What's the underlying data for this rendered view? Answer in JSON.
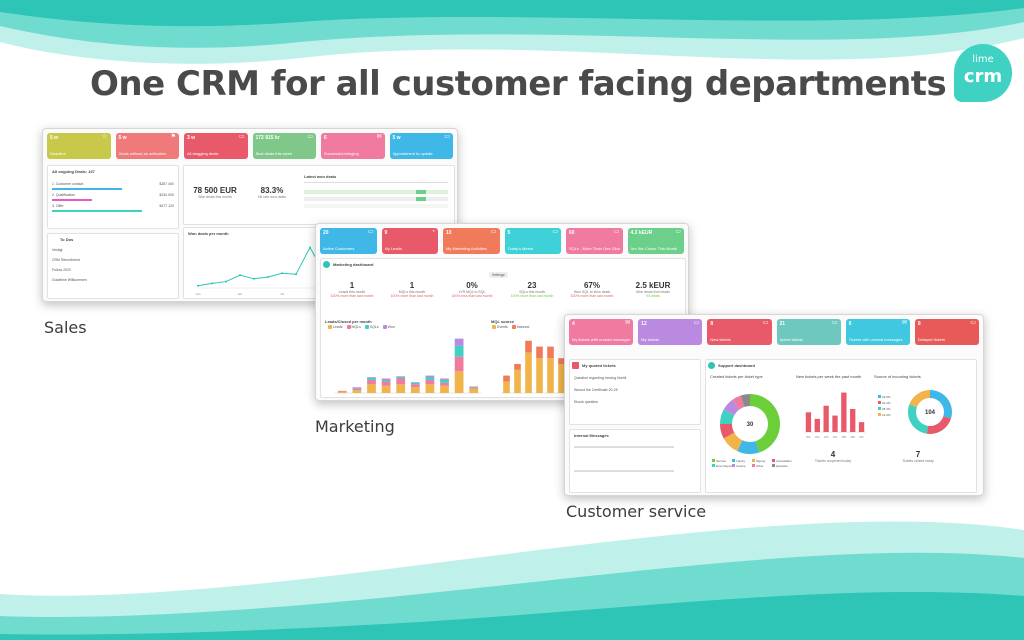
{
  "headline": "One CRM for all customer facing departments",
  "logo": {
    "line1": "lime",
    "line2": "crm",
    "color": "#3fd1c2"
  },
  "captions": {
    "sales": "Sales",
    "marketing": "Marketing",
    "customer_service": "Customer service"
  },
  "colors": {
    "teal_light": "#bff0ea",
    "teal": "#6fdccf",
    "teal_dark": "#2ec4b6"
  },
  "sales": {
    "tiles": [
      {
        "value": "5 w",
        "label": "Deadline",
        "color": "#c8c84a"
      },
      {
        "value": "5 w",
        "label": "Deals without an activation",
        "color": "#f07a7a"
      },
      {
        "value": "3 w",
        "label": "All stagging deals",
        "color": "#e85a6a"
      },
      {
        "value": "172 815 kr",
        "label": "Best deals this week",
        "color": "#7fc88a"
      },
      {
        "value": "6",
        "label": "Successful bringing",
        "color": "#f07aa0"
      },
      {
        "value": "5 w",
        "label": "Appointment to update",
        "color": "#3fb8e8"
      }
    ],
    "deals": {
      "title": "All ongoing Deals: 167",
      "rows": [
        "1. Customer contact",
        "2. Qualification",
        "3. Offer"
      ],
      "amounts": [
        "$287 400",
        "$234 000",
        "$477 120"
      ]
    },
    "kpis": [
      {
        "value": "78 500 EUR",
        "label": "Won deals this month"
      },
      {
        "value": "83.3%",
        "label": "Hit rate won deals"
      }
    ],
    "latest_title": "Latest won deals",
    "todo": {
      "title": "To Dos",
      "items": [
        "Vestigt",
        "CRM Recruitment",
        "Follow 2020",
        "Guideline Willkommen"
      ]
    },
    "chart_title": "Won deals per month",
    "chart_data": {
      "type": "line",
      "x": [
        "Jan",
        "Feb",
        "Mar",
        "Apr",
        "May",
        "Jun",
        "Jul",
        "Aug",
        "Sep",
        "Oct",
        "Nov",
        "Dec"
      ],
      "series": [
        {
          "values": [
            5,
            10,
            14,
            28,
            20,
            24,
            32,
            30,
            88,
            34,
            28,
            30
          ]
        }
      ],
      "ylim": [
        0,
        100
      ]
    }
  },
  "marketing": {
    "tiles": [
      {
        "value": "20",
        "label": "Active Customers",
        "color": "#3fb8e8"
      },
      {
        "value": "9",
        "label": "My Leads",
        "color": "#e85a6a"
      },
      {
        "value": "10",
        "label": "My Marketing Activities",
        "color": "#f07a5a"
      },
      {
        "value": "5",
        "label": "Today's Meets",
        "color": "#3fd1d8"
      },
      {
        "value": "60",
        "label": "SQLs - More Than One Click",
        "color": "#f07aa0"
      },
      {
        "value": "4.3 kEUR",
        "label": "Are We Closer This Month",
        "color": "#6ccf8a"
      }
    ],
    "dashboard_title": "Marketing dashboard",
    "settings_label": "Settings",
    "kpis": [
      {
        "value": "1",
        "label": "Leads this month",
        "sub": "100% more than last month"
      },
      {
        "value": "1",
        "label": "MQLs this month",
        "sub": "100% more than last month"
      },
      {
        "value": "0%",
        "label": "LYR MQL to SQL",
        "sub": "100% less than last month"
      },
      {
        "value": "23",
        "label": "SQLs this month",
        "sub": "100% more than last month"
      },
      {
        "value": "67%",
        "label": "Won SQL to Won deals",
        "sub": "100% more than last month"
      },
      {
        "value": "2.5 kEUR",
        "label": "Won deals from leads",
        "sub": "93 deals"
      }
    ],
    "chart1": {
      "title": "Leads/Closed per month",
      "legend": [
        "Leads",
        "MQLs",
        "SQLs",
        "Won"
      ],
      "colors": [
        "#f0b44a",
        "#f07aa0",
        "#3fd1c2",
        "#b98ae0"
      ],
      "chart_data": {
        "type": "bar",
        "categories": [
          "Jan",
          "Feb",
          "Mar",
          "Apr",
          "May",
          "Jun",
          "Jul",
          "Aug",
          "Sep",
          "Oct"
        ],
        "series": [
          {
            "name": "Leads",
            "values": [
              2,
              4,
              12,
              10,
              12,
              8,
              12,
              10,
              30,
              6
            ]
          },
          {
            "name": "MQLs",
            "values": [
              1,
              2,
              6,
              6,
              8,
              4,
              6,
              4,
              20,
              2
            ]
          },
          {
            "name": "SQLs",
            "values": [
              0,
              1,
              3,
              2,
              2,
              2,
              4,
              4,
              15,
              1
            ]
          },
          {
            "name": "Won",
            "values": [
              0,
              1,
              1,
              2,
              1,
              1,
              2,
              2,
              10,
              0
            ]
          }
        ],
        "ylim": [
          0,
          80
        ]
      }
    },
    "chart2": {
      "title": "MQL source",
      "legend": [
        "Events",
        "Inbound"
      ],
      "colors": [
        "#f0b44a",
        "#f07a5a"
      ],
      "chart_data": {
        "type": "bar",
        "categories": [
          "A",
          "B",
          "C",
          "D",
          "E",
          "F"
        ],
        "series": [
          {
            "name": "Events",
            "values": [
              2,
              4,
              7,
              6,
              6,
              5
            ]
          },
          {
            "name": "Inbound",
            "values": [
              1,
              1,
              2,
              2,
              2,
              1
            ]
          }
        ],
        "ylim": [
          0,
          10
        ]
      }
    }
  },
  "service": {
    "tiles": [
      {
        "value": "4",
        "label": "My tickets with unread messages",
        "color": "#f07aa0"
      },
      {
        "value": "12",
        "label": "My tickets",
        "color": "#b98ae0"
      },
      {
        "value": "8",
        "label": "New tickets",
        "color": "#e85a6a"
      },
      {
        "value": "21",
        "label": "Active tickets",
        "color": "#6fc8c0"
      },
      {
        "value": "6",
        "label": "Tickets with unread messages",
        "color": "#3fc8e0"
      },
      {
        "value": "8",
        "label": "Delayed tickets",
        "color": "#e85a5a"
      }
    ],
    "list_title": "My quoted tickets",
    "list_items": [
      "Question regarding moving Norbit",
      "Wound the Certificate 20-25",
      "Ebook question"
    ],
    "messages_title": "Internal Messages",
    "dashboard_title": "Support dashboard",
    "donut1": {
      "title": "Created tickets per ticket type",
      "center": "30",
      "chart_data": {
        "type": "pie",
        "labels": [
          "Service",
          "Inquiry",
          "Signup",
          "Cancellation",
          "Error Report",
          "Invoice",
          "Other",
          "Question"
        ],
        "values": [
          45,
          12,
          10,
          8,
          8,
          7,
          5,
          5
        ],
        "colors": [
          "#6ccf3a",
          "#3fb8e8",
          "#f0b44a",
          "#e85a6a",
          "#3fd1c2",
          "#b98ae0",
          "#f07aa0",
          "#8a8a8a"
        ]
      }
    },
    "bars_title": "New tickets per week the past month",
    "bars": {
      "chart_data": {
        "type": "bar",
        "categories": [
          "W1",
          "W2",
          "W3",
          "W4",
          "W5",
          "W6",
          "W7"
        ],
        "values": [
          6,
          4,
          8,
          5,
          12,
          7,
          3
        ],
        "ylim": [
          0,
          14
        ]
      }
    },
    "donut2": {
      "title": "Source of incoming tickets",
      "center": "104",
      "chart_data": {
        "type": "pie",
        "labels": [
          "Phone",
          "Email",
          "Web",
          "Chat"
        ],
        "values": [
          29.9,
          22.4,
          28.3,
          19.4
        ],
        "colors": [
          "#3fb8e8",
          "#e85a6a",
          "#3fd1c2",
          "#f0b44a"
        ]
      }
    },
    "stat1": {
      "value": "4",
      "label": "Tickets reopened today"
    },
    "stat2": {
      "value": "7",
      "label": "Tickets closed today"
    }
  }
}
